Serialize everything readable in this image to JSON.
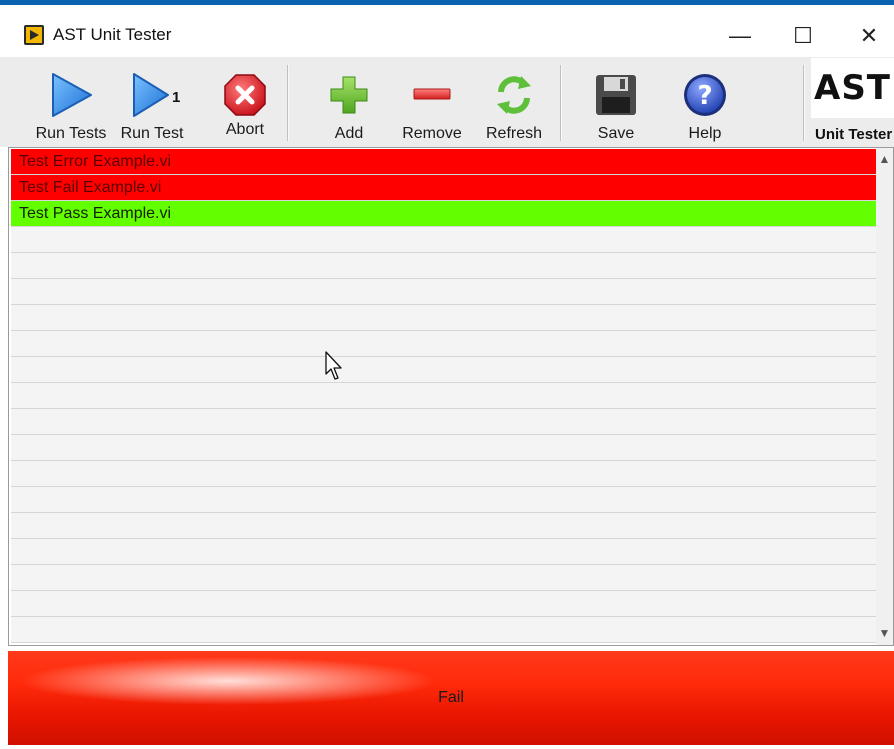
{
  "window": {
    "title": "AST Unit Tester",
    "controls": {
      "minimize": "—",
      "maximize": "☐",
      "close": "✕"
    }
  },
  "toolbar": {
    "run_tests": "Run Tests",
    "run_test": "Run Test",
    "run_test_badge": "1",
    "abort": "Abort",
    "add": "Add",
    "remove": "Remove",
    "refresh": "Refresh",
    "save": "Save",
    "help": "Help"
  },
  "logo": {
    "text": "AST",
    "subtitle": "Unit Tester"
  },
  "tests": [
    {
      "name": "Test Error Example.vi",
      "status": "error"
    },
    {
      "name": "Test Fail Example.vi",
      "status": "fail"
    },
    {
      "name": "Test Pass Example.vi",
      "status": "pass"
    }
  ],
  "status_bar": {
    "text": "Fail"
  },
  "colors": {
    "error": "#ff0000",
    "fail": "#ff0000",
    "pass": "#63ff00",
    "accent": "#0b62b0"
  },
  "icons": [
    "play-icon",
    "play-one-icon",
    "abort-icon",
    "add-icon",
    "remove-icon",
    "refresh-icon",
    "save-icon",
    "help-icon"
  ]
}
